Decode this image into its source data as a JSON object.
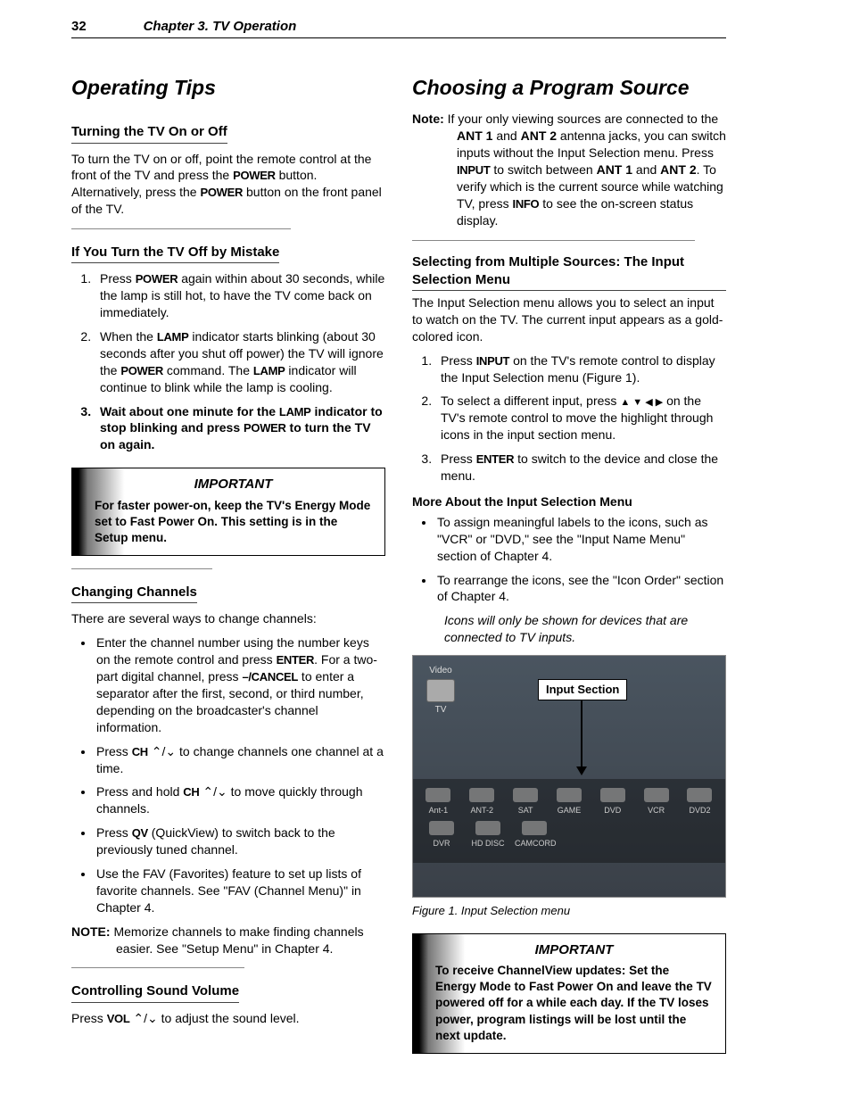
{
  "header": {
    "page_no": "32",
    "chapter": "Chapter 3.  TV Operation"
  },
  "left": {
    "h1": "Operating Tips",
    "s1_title": "Turning the TV On or Off",
    "s1_body_a": "To turn the TV on or off, point the remote control at the front of the TV and press the ",
    "s1_body_b": " button.  Alternatively, press the ",
    "s1_body_c": " button on the front panel of the TV.",
    "s2_title": "If You Turn the TV Off by Mistake",
    "s2_li1_a": "Press ",
    "s2_li1_b": " again within about 30 seconds, while the lamp is still hot, to have the TV come back on immediately.",
    "s2_li2_a": "When the ",
    "s2_li2_b": " indicator starts blinking (about 30 seconds after you shut off power) the TV will ignore the ",
    "s2_li2_c": " command.  The ",
    "s2_li2_d": " indicator will continue to blink while the lamp is cooling.",
    "s2_li3_a": "Wait about one minute for the ",
    "s2_li3_b": " indicator to stop blinking and press ",
    "s2_li3_c": " to turn the TV on again.",
    "imp1_title": "IMPORTANT",
    "imp1_body": "For faster power-on, keep the TV's Energy Mode set to Fast Power On.  This setting is in the Setup menu.",
    "s3_title": "Changing Channels",
    "s3_intro": "There are several ways to change channels:",
    "s3_b1_a": "Enter the channel number using the number keys on the remote control and press ",
    "s3_b1_b": ".  For a two-part digital channel, press ",
    "s3_b1_c": " to enter a separator after the first, second, or third number, depending on the broadcaster's channel information.",
    "s3_b2_a": "Press ",
    "s3_b2_b": " to change channels one channel at a time.",
    "s3_b3_a": "Press and hold  ",
    "s3_b3_b": " to move quickly through channels.",
    "s3_b4_a": "Press ",
    "s3_b4_b": " (QuickView) to switch back to the previously tuned channel.",
    "s3_b5": "Use the FAV (Favorites) feature to set up lists of favorite channels.  See \"FAV (Channel Menu)\" in Chapter 4.",
    "s3_note_lbl": "NOTE:",
    "s3_note_body": "  Memorize channels to make finding channels easier.  See \"Setup Menu\" in Chapter 4.",
    "s4_title": "Controlling Sound Volume",
    "s4_body_a": "Press ",
    "s4_body_b": " to adjust the sound level.",
    "keys": {
      "power": "POWER",
      "lamp": "LAMP",
      "enter": "ENTER",
      "cancel": "–/CANCEL",
      "ch": "CH",
      "qv": "QV",
      "vol": "VOL",
      "input": "INPUT",
      "info": "INFO"
    },
    "chev": " ⌃/⌄"
  },
  "right": {
    "h1": "Choosing a Program Source",
    "note_lbl": "Note:",
    "note_a": "   If your only viewing sources are connected to the ",
    "note_b": " and ",
    "note_c": " antenna jacks, you can switch inputs without the Input Selection menu.  Press ",
    "note_d": " to switch between ",
    "note_e": " and ",
    "note_f": ".  To verify which is the current source while watching TV, press ",
    "note_g": " to see the on-screen status display.",
    "ant1": "ANT 1",
    "ant2": "ANT 2",
    "s1_title": "Selecting from Multiple Sources:  The Input Selection Menu",
    "s1_intro": "The Input Selection menu allows you to select an input to watch on the TV.  The current input appears as a gold-colored icon.",
    "s1_li1_a": "Press ",
    "s1_li1_b": " on the TV's remote control to display the Input Selection menu (Figure 1).",
    "s1_li2_a": "To select a different input, press ",
    "s1_li2_b": " on the TV's remote control to move the highlight through icons in the input section menu.",
    "s1_li3_a": "Press ",
    "s1_li3_b": " to switch to the device and close the menu.",
    "arrows": "▲ ▼ ◀ ▶",
    "more_title": "More About the Input Selection Menu",
    "more_b1": "To assign meaningful labels to the icons, such as \"VCR\" or \"DVD,\" see the \"Input Name Menu\" section of Chapter 4.",
    "more_b2": "To rearrange the icons, see the \"Icon Order\" section of Chapter 4.",
    "more_note": "Icons will only be shown for devices that are connected to TV inputs.",
    "fig_label": "Input Section",
    "fig_video": "Video",
    "fig_tv": "TV",
    "icons_row1": [
      "Ant-1",
      "ANT-2",
      "SAT",
      "GAME",
      "DVD",
      "VCR",
      "DVD2"
    ],
    "icons_row2": [
      "DVR",
      "HD DISC",
      "CAMCORD"
    ],
    "fig_caption": "Figure 1.  Input Selection menu",
    "imp2_title": "IMPORTANT",
    "imp2_body": "To receive ChannelView updates:   Set the Energy Mode to Fast Power On and leave the TV powered off for a while each day.   If the TV loses power, program listings will be lost until the next update."
  }
}
